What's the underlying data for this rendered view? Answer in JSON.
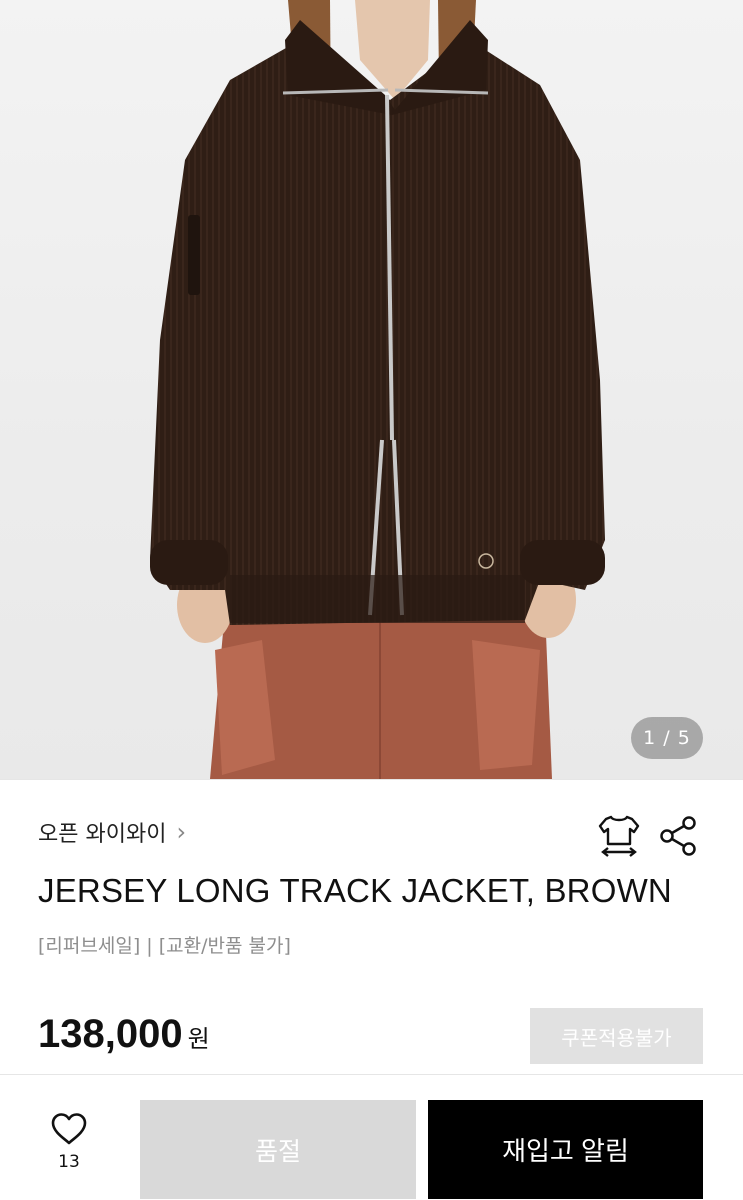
{
  "gallery": {
    "pager": "1 / 5",
    "image_icon": "product-photo"
  },
  "product": {
    "brand": "오픈 와이와이",
    "brand_chevron_icon": "chevron-right-icon",
    "title": "JERSEY LONG TRACK JACKET, BROWN",
    "notice": "[리퍼브세일] | [교환/반품 불가]",
    "price": "138,000",
    "price_unit": "원",
    "coupon_label": "쿠폰적용불가",
    "icons": {
      "size": "shirt-size-icon",
      "share": "share-icon"
    }
  },
  "bottom_bar": {
    "like_icon": "heart-icon",
    "like_count": "13",
    "soldout_label": "품절",
    "restock_label": "재입고 알림"
  },
  "colors": {
    "soldout_bg": "#d9d9d9",
    "restock_bg": "#000000",
    "coupon_bg": "#e1e1e1",
    "jacket": "#2e1d14",
    "pants": "#a55a44"
  }
}
